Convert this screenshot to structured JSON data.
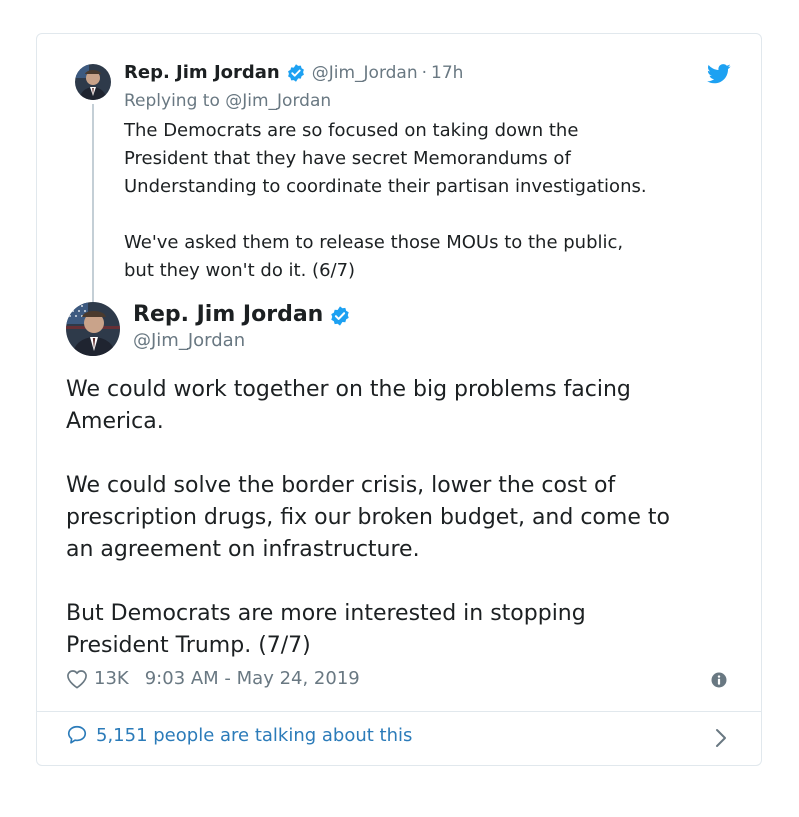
{
  "colors": {
    "text": "#1c2022",
    "secondary": "#697882",
    "link": "#2b7bb9",
    "twitter_blue": "#1da1f2",
    "border": "#e1e8ed",
    "thread_line": "#c4cfd6"
  },
  "parent_tweet": {
    "author_name": "Rep. Jim Jordan",
    "handle": "@Jim_Jordan",
    "separator": "·",
    "time": "17h",
    "replying_to": "Replying to @Jim_Jordan",
    "text": "The Democrats are so focused on taking down the\nPresident that they have secret Memorandums of\nUnderstanding to coordinate their partisan investigations.\n\nWe've asked them to release those MOUs to the public,\nbut they won't do it. (6/7)",
    "icons": [
      "avatar",
      "verified-badge-icon",
      "twitter-bird-icon"
    ]
  },
  "main_tweet": {
    "author_name": "Rep. Jim Jordan",
    "handle": "@Jim_Jordan",
    "text": "We could work together on the big problems facing\nAmerica.\n\nWe could solve the border crisis, lower the cost of\nprescription drugs, fix our broken budget, and come to\nan agreement on infrastructure.\n\nBut Democrats are more interested in stopping\nPresident Trump. (7/7)",
    "likes": "13K",
    "timestamp": "9:03 AM - May 24, 2019",
    "icons": [
      "avatar",
      "verified-badge-icon",
      "heart-icon",
      "info-icon"
    ]
  },
  "footer": {
    "label": "5,151 people are talking about this",
    "icons": [
      "speech-bubble-icon",
      "chevron-right-icon"
    ]
  }
}
